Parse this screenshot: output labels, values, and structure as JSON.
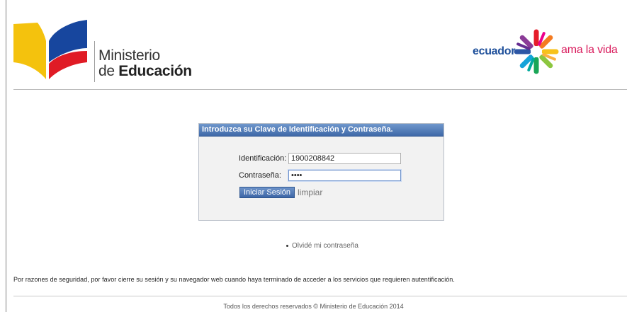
{
  "header": {
    "ministry_line1": "Ministerio",
    "ministry_line2_prefix": "de ",
    "ministry_line2_bold": "Educación",
    "campaign_left": "ecuador",
    "campaign_right": "ama la vida",
    "logo_colors": {
      "yellow": "#f4c20d",
      "blue": "#17469e",
      "red": "#e01b25"
    }
  },
  "login": {
    "title": "Introduzca su Clave de Identificación y Contraseña.",
    "id_label": "Identificación:",
    "id_value": "1900208842",
    "password_label": "Contraseña:",
    "password_value": "••••",
    "submit_label": "Iniciar Sesión",
    "clear_label": "limpiar"
  },
  "links": {
    "forgot_password": "Olvidé mi contraseña"
  },
  "notice": "Por razones de seguridad, por favor cierre su sesión y su navegador web cuando haya terminado de acceder a los servicios que requieren autentificación.",
  "footer": {
    "copyright": "Todos los derechos reservados © Ministerio de Educación 2014"
  }
}
